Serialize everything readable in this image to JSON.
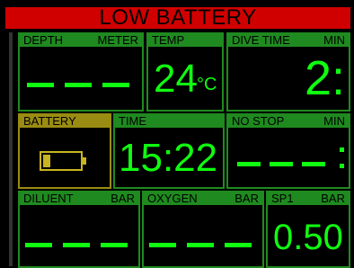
{
  "banner": {
    "text": "LOW BATTERY"
  },
  "panels": {
    "depth": {
      "label": "DEPTH",
      "unit": "METER"
    },
    "temp": {
      "label": "TEMP",
      "value": "24",
      "unit": "°C"
    },
    "dive_time": {
      "label": "DIVE TIME",
      "unit": "MIN",
      "value": "2:"
    },
    "battery": {
      "label": "BATTERY",
      "level": 0.2
    },
    "time": {
      "label": "TIME",
      "value": "15:22"
    },
    "no_stop": {
      "label": "NO STOP",
      "unit": "MIN"
    },
    "diluent": {
      "label": "DILUENT",
      "unit": "BAR"
    },
    "oxygen": {
      "label": "OXYGEN",
      "unit": "BAR"
    },
    "sp1": {
      "label": "SP1",
      "unit": "BAR",
      "value": "0.50"
    }
  },
  "colors": {
    "accent": "#10ff10",
    "panel_border": "#1f8a1f",
    "warning": "#d10000",
    "battery": "#9a8c12"
  }
}
